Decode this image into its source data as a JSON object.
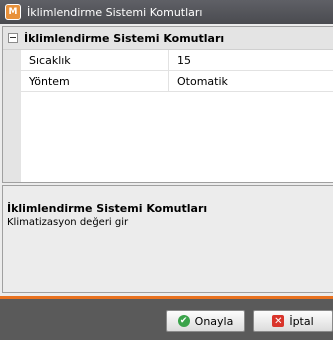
{
  "window": {
    "title": "İklimlendirme Sistemi Komutları",
    "app_icon": "M"
  },
  "grid": {
    "category": "İklimlendirme Sistemi Komutları",
    "rows": [
      {
        "name": "Sıcaklık",
        "value": "15"
      },
      {
        "name": "Yöntem",
        "value": "Otomatik"
      }
    ]
  },
  "description": {
    "title": "İklimlendirme Sistemi Komutları",
    "text": "Klimatizasyon değeri gir"
  },
  "buttons": {
    "ok": "Onayla",
    "cancel": "İptal"
  },
  "colors": {
    "accent": "#e8711f",
    "titlebar": "#55565b",
    "ok_icon": "#3aa34a",
    "cancel_icon": "#d9342b"
  }
}
